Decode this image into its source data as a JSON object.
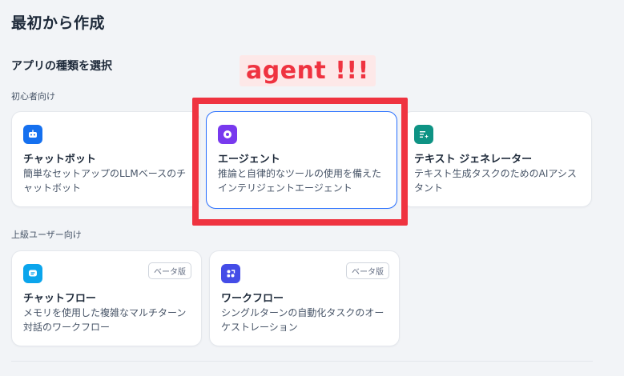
{
  "page": {
    "title": "最初から作成"
  },
  "section": {
    "title": "アプリの種類を選択"
  },
  "groups": {
    "beginner": "初心者向け",
    "advanced": "上級ユーザー向け"
  },
  "cards": {
    "chatbot": {
      "title": "チャットボット",
      "desc": "簡単なセットアップのLLMベースのチャットボット",
      "icon": "chatbot-icon",
      "color": "#1570ef"
    },
    "agent": {
      "title": "エージェント",
      "desc": "推論と自律的なツールの使用を備えたインテリジェントエージェント",
      "icon": "agent-icon",
      "color": "#7839ee",
      "selected": true
    },
    "textgen": {
      "title": "テキスト ジェネレーター",
      "desc": "テキスト生成タスクのためのAIアシスタント",
      "icon": "text-generator-icon",
      "color": "#0e9384"
    },
    "chatflow": {
      "title": "チャットフロー",
      "desc": "メモリを使用した複雑なマルチターン対話のワークフロー",
      "icon": "chatflow-icon",
      "color": "#0ba5ec",
      "badge": "ベータ版"
    },
    "workflow": {
      "title": "ワークフロー",
      "desc": "シングルターンの自動化タスクのオーケストレーション",
      "icon": "workflow-icon",
      "color": "#444ce7",
      "badge": "ベータ版"
    }
  },
  "annotation": {
    "label": "agent !!!",
    "color": "#ef3340"
  }
}
